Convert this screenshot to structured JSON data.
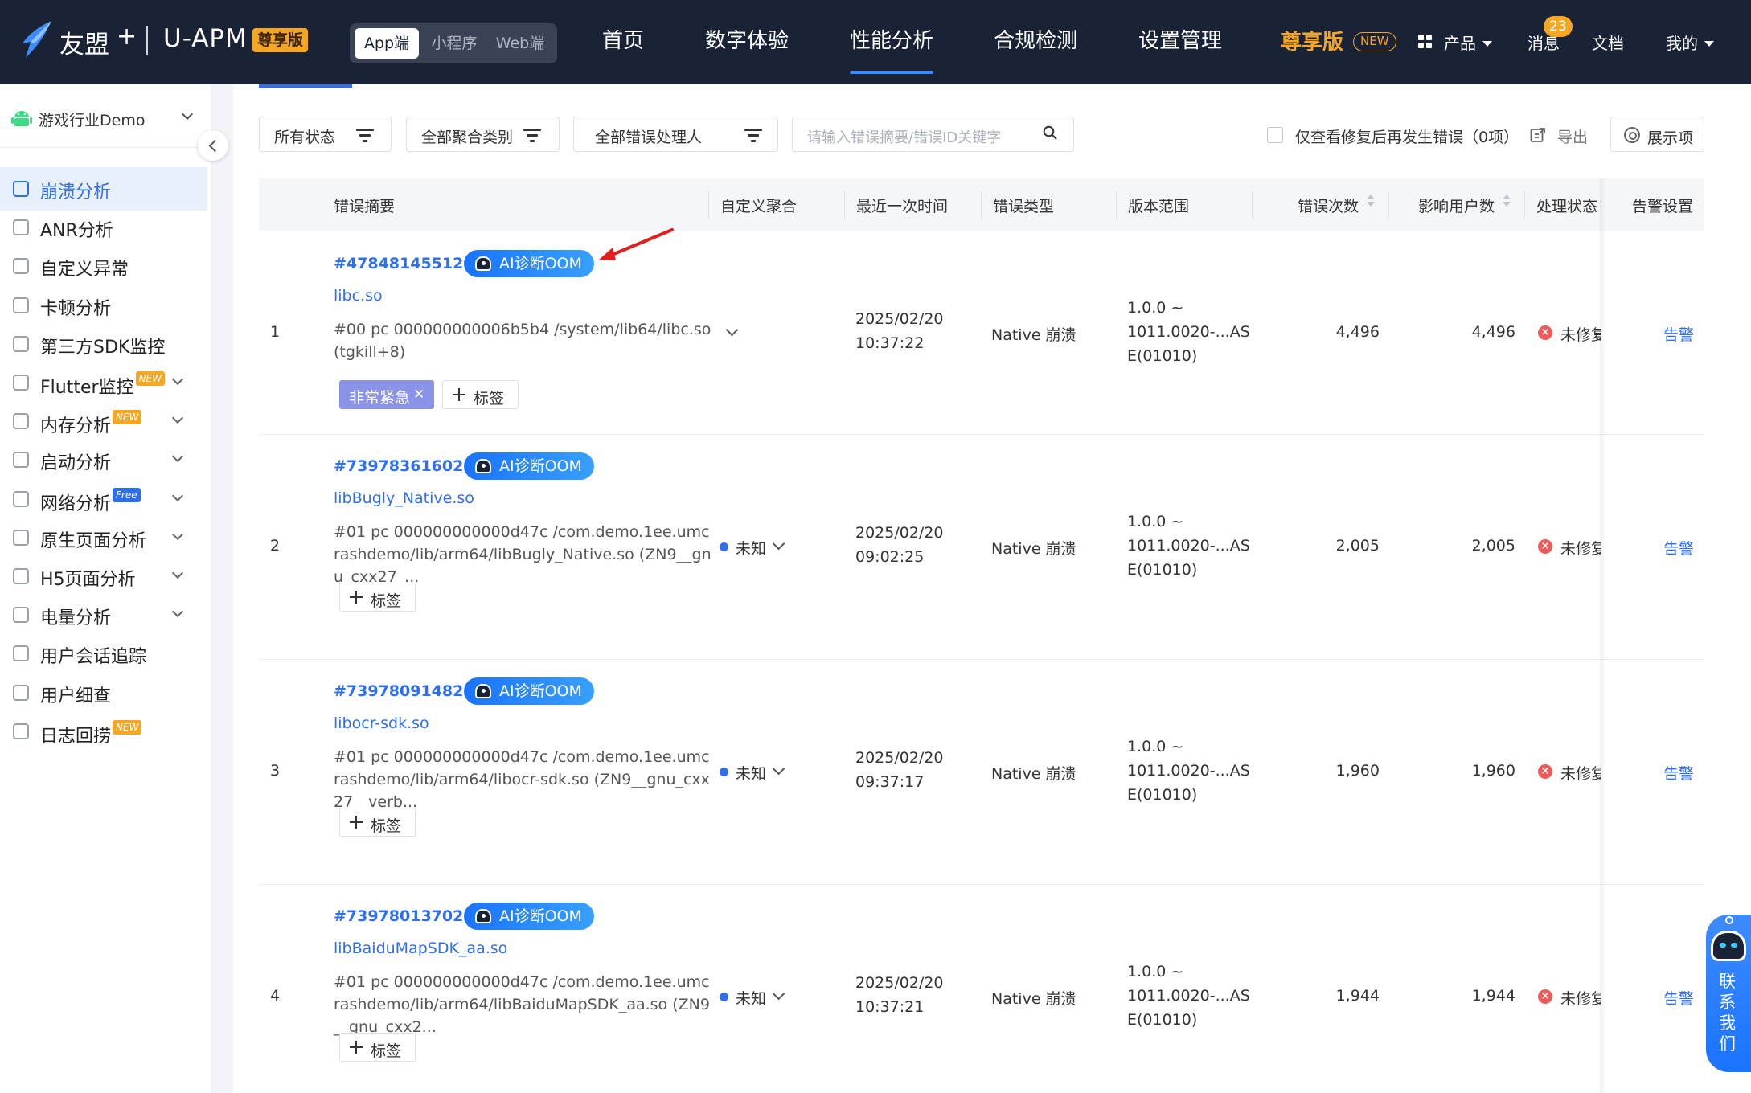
{
  "topbar": {
    "brand": "友盟",
    "brand_plus": "+",
    "product": "U-APM",
    "vip_badge": "尊享版",
    "segments": [
      "App端",
      "小程序",
      "Web端"
    ],
    "nav": [
      "首页",
      "数字体验",
      "性能分析",
      "合规检测",
      "设置管理"
    ],
    "active_nav": "性能分析",
    "vip_nav": "尊享版",
    "new_pill": "NEW",
    "products": "产品",
    "messages": "消息",
    "message_count": "23",
    "docs": "文档",
    "mine": "我的"
  },
  "sidebar": {
    "app_name": "游戏行业Demo",
    "items": [
      {
        "label": "崩溃分析",
        "active": true,
        "icon": "crash-icon"
      },
      {
        "label": "ANR分析",
        "icon": "anr-icon"
      },
      {
        "label": "自定义异常",
        "icon": "custom-exception-icon"
      },
      {
        "label": "卡顿分析",
        "icon": "lag-icon"
      },
      {
        "label": "第三方SDK监控",
        "icon": "sdk-icon"
      },
      {
        "label": "Flutter监控",
        "tag": "NEW",
        "expandable": true,
        "icon": "flutter-icon"
      },
      {
        "label": "内存分析",
        "tag": "NEW",
        "expandable": true,
        "icon": "memory-icon"
      },
      {
        "label": "启动分析",
        "expandable": true,
        "icon": "launch-icon"
      },
      {
        "label": "网络分析",
        "tag": "Free",
        "expandable": true,
        "icon": "wifi-icon"
      },
      {
        "label": "原生页面分析",
        "expandable": true,
        "icon": "native-page-icon"
      },
      {
        "label": "H5页面分析",
        "expandable": true,
        "icon": "h5-icon"
      },
      {
        "label": "电量分析",
        "expandable": true,
        "icon": "battery-icon"
      },
      {
        "label": "用户会话追踪",
        "icon": "session-icon"
      },
      {
        "label": "用户细查",
        "icon": "user-detail-icon"
      },
      {
        "label": "日志回捞",
        "tag": "NEW",
        "icon": "log-icon"
      }
    ]
  },
  "filters": {
    "status": "所有状态",
    "aggregation": "全部聚合类别",
    "handler": "全部错误处理人",
    "search_placeholder": "请输入错误摘要/错误ID关键字",
    "only_after_fix": "仅查看修复后再发生错误（0项）",
    "export": "导出",
    "display": "展示项"
  },
  "table": {
    "headers": [
      "错误摘要",
      "自定义聚合",
      "最近一次时间",
      "错误类型",
      "版本范围",
      "错误次数",
      "影响用户数",
      "处理状态",
      "告警设置"
    ],
    "ai_label": "AI诊断OOM",
    "tag_add_label": "标签",
    "rows": [
      {
        "index": "1",
        "id": "#4784814551231",
        "lib": "libc.so",
        "stack": "#00 pc 000000000006b5b4 /system/lib64/libc.so (tgkill+8)",
        "urgent_tag": "非常紧急",
        "aggregation": "",
        "date": "2025/02/20",
        "time": "10:37:22",
        "type": "Native 崩溃",
        "version_1": "1.0.0 ~",
        "version_2": "1011.0020-...AS",
        "version_3": "E(01010)",
        "errors": "4,496",
        "users": "4,496",
        "status": "未修复",
        "alarm": "告警"
      },
      {
        "index": "2",
        "id": "#7397836160231",
        "lib": "libBugly_Native.so",
        "stack": "#01 pc 000000000000d47c /com.demo.1ee.umcrashdemo/lib/arm64/libBugly_Native.so (ZN9__gnu_cxx27_...",
        "aggregation": "未知",
        "date": "2025/02/20",
        "time": "09:02:25",
        "type": "Native 崩溃",
        "version_1": "1.0.0 ~",
        "version_2": "1011.0020-...AS",
        "version_3": "E(01010)",
        "errors": "2,005",
        "users": "2,005",
        "status": "未修复",
        "alarm": "告警"
      },
      {
        "index": "3",
        "id": "#7397809148231",
        "lib": "libocr-sdk.so",
        "stack": "#01 pc 000000000000d47c /com.demo.1ee.umcrashdemo/lib/arm64/libocr-sdk.so (ZN9__gnu_cxx27__verb...",
        "aggregation": "未知",
        "date": "2025/02/20",
        "time": "09:37:17",
        "type": "Native 崩溃",
        "version_1": "1.0.0 ~",
        "version_2": "1011.0020-...AS",
        "version_3": "E(01010)",
        "errors": "1,960",
        "users": "1,960",
        "status": "未修复",
        "alarm": "告警"
      },
      {
        "index": "4",
        "id": "#7397801370231",
        "lib": "libBaiduMapSDK_aa.so",
        "stack": "#01 pc 000000000000d47c /com.demo.1ee.umcrashdemo/lib/arm64/libBaiduMapSDK_aa.so (ZN9__gnu_cxx2...",
        "aggregation": "未知",
        "date": "2025/02/20",
        "time": "10:37:21",
        "type": "Native 崩溃",
        "version_1": "1.0.0 ~",
        "version_2": "1011.0020-...AS",
        "version_3": "E(01010)",
        "errors": "1,944",
        "users": "1,944",
        "status": "未修复",
        "alarm": "告警"
      }
    ]
  },
  "contact": "联系我们",
  "colors": {
    "topbar_bg": "#1a2236",
    "accent": "#2f6fed",
    "vip": "#f5a623",
    "danger": "#f05a5a",
    "urgent_tag": "#8b93e8"
  }
}
